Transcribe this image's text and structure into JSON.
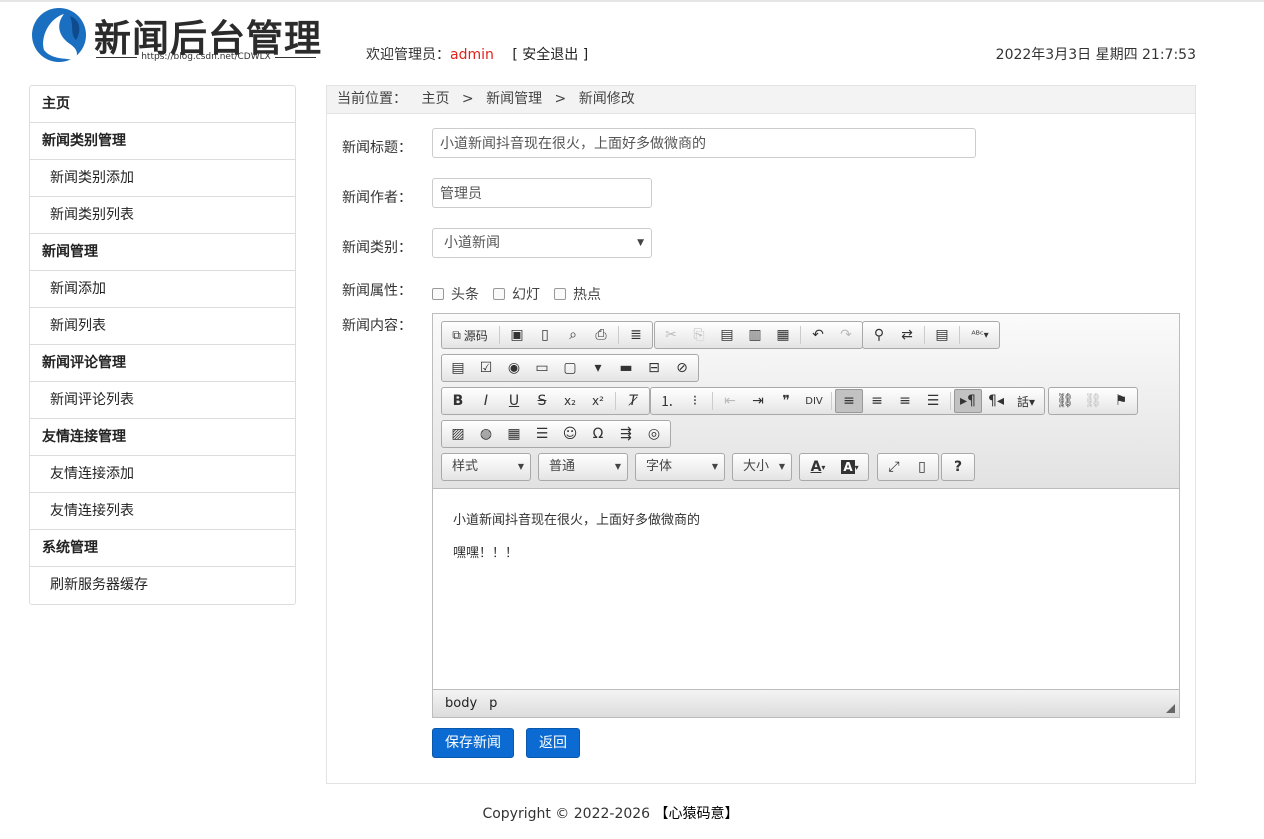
{
  "header": {
    "logo_title": "新闻后台管理",
    "logo_url": "https://blog.csdn.net/CDWLX",
    "welcome_prefix": "欢迎管理员：",
    "admin_name": "admin",
    "logout": "[ 安全退出 ]",
    "datetime": "2022年3月3日 星期四 21:7:53"
  },
  "sidebar": {
    "items": [
      {
        "label": "主页"
      },
      {
        "label": "新闻类别管理"
      },
      {
        "label": "新闻类别添加"
      },
      {
        "label": "新闻类别列表"
      },
      {
        "label": "新闻管理"
      },
      {
        "label": "新闻添加"
      },
      {
        "label": "新闻列表"
      },
      {
        "label": "新闻评论管理"
      },
      {
        "label": "新闻评论列表"
      },
      {
        "label": "友情连接管理"
      },
      {
        "label": "友情连接添加"
      },
      {
        "label": "友情连接列表"
      },
      {
        "label": "系统管理"
      },
      {
        "label": "刷新服务器缓存"
      }
    ]
  },
  "breadcrumb": {
    "lead": "当前位置：",
    "items": [
      "主页",
      "新闻管理",
      "新闻修改"
    ],
    "sep": ">"
  },
  "form": {
    "title_label": "新闻标题：",
    "title_value": "小道新闻抖音现在很火，上面好多做微商的",
    "author_label": "新闻作者：",
    "author_value": "管理员",
    "type_label": "新闻类别：",
    "type_value": "小道新闻",
    "attr_label": "新闻属性：",
    "attrs": [
      "头条",
      "幻灯",
      "热点"
    ],
    "content_label": "新闻内容："
  },
  "editor": {
    "source_label": "源码",
    "combos": [
      "样式",
      "普通",
      "字体",
      "大小"
    ],
    "content": [
      "小道新闻抖音现在很火，上面好多做微商的",
      "嘿嘿！！！"
    ],
    "path": [
      "body",
      "p"
    ]
  },
  "buttons": {
    "save": "保存新闻",
    "back": "返回"
  },
  "footer": {
    "copyright": "Copyright © 2022-2026",
    "brand": "【心猿码意】"
  }
}
